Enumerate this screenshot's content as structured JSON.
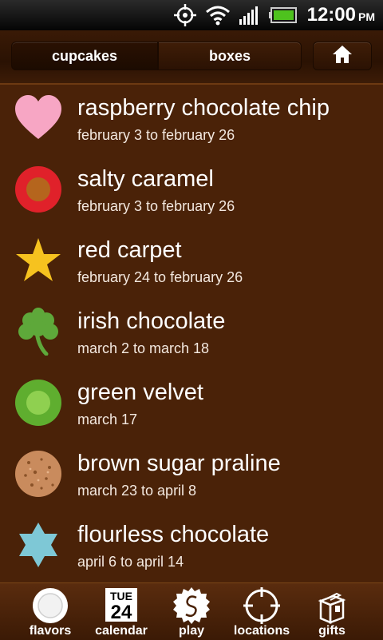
{
  "status_bar": {
    "time": "12:00",
    "ampm": "PM"
  },
  "header": {
    "segments": [
      {
        "label": "cupcakes"
      },
      {
        "label": "boxes"
      }
    ],
    "home_icon": "home-icon"
  },
  "flavors": [
    {
      "name": "raspberry chocolate chip",
      "dates": "february 3 to february 26",
      "icon": "heart-icon",
      "color": "#f7a6c4"
    },
    {
      "name": "salty caramel",
      "dates": "february 3 to february 26",
      "icon": "ring-icon",
      "color": "#e0212a"
    },
    {
      "name": "red carpet",
      "dates": "february 24 to february 26",
      "icon": "star-icon",
      "color": "#f6c21f"
    },
    {
      "name": "irish chocolate",
      "dates": "march 2 to march 18",
      "icon": "shamrock-icon",
      "color": "#5ea83a"
    },
    {
      "name": "green velvet",
      "dates": "march 17",
      "icon": "green-circle-icon",
      "color": "#7cc142"
    },
    {
      "name": "brown sugar praline",
      "dates": "march 23 to april 8",
      "icon": "praline-cookie-icon",
      "color": "#c98b5d"
    },
    {
      "name": "flourless chocolate",
      "dates": "april 6 to april 14",
      "icon": "six-point-star-icon",
      "color": "#7ec8d6"
    }
  ],
  "tabs": [
    {
      "label": "flavors",
      "icon": "flavors-circle-icon"
    },
    {
      "label": "calendar",
      "icon": "calendar-icon",
      "day": "TUE",
      "date": "24"
    },
    {
      "label": "play",
      "icon": "play-badge-icon"
    },
    {
      "label": "locations",
      "icon": "crosshair-icon"
    },
    {
      "label": "gifts",
      "icon": "gift-box-icon"
    }
  ]
}
